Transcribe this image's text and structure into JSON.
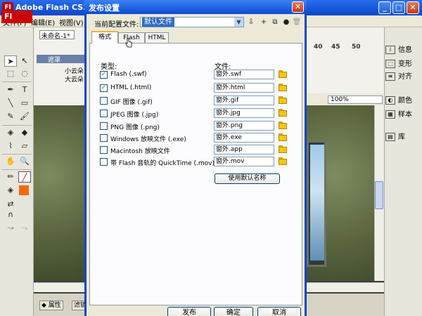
{
  "flash_window": {
    "title": "Adobe Flash CS3 Pr",
    "app_icon": "Fl",
    "menu": [
      "文件(F)",
      "编辑(E)",
      "视图(V)"
    ],
    "logo": "Fl",
    "document_tab": "未命名-1*",
    "layers": [
      "遮罩",
      "小云朵",
      "大云朵"
    ],
    "frame_numbers": [
      "40",
      "45",
      "50"
    ],
    "zoom": "100%",
    "bottom_tabs": [
      "属性",
      "滤镜"
    ]
  },
  "right_panel": {
    "items": [
      {
        "icon": "info-icon",
        "label": "信息"
      },
      {
        "icon": "transform-icon",
        "label": "变形"
      },
      {
        "icon": "align-icon",
        "label": "对齐"
      },
      {
        "icon": "color-icon",
        "label": "颜色"
      },
      {
        "icon": "swatches-icon",
        "label": "样本"
      },
      {
        "icon": "library-icon",
        "label": "库"
      }
    ]
  },
  "dialog": {
    "title": "发布设置",
    "close_glyph": "✕",
    "profile_label": "当前配置文件:",
    "profile_value": "默认文件",
    "tabs": [
      "格式",
      "Flash",
      "HTML"
    ],
    "active_tab": "格式",
    "type_header": "类型:",
    "file_header": "文件:",
    "formats": [
      {
        "label": "Flash (.swf)",
        "checked": true,
        "file": "窗外.swf"
      },
      {
        "label": "HTML (.html)",
        "checked": true,
        "file": "窗外.html"
      },
      {
        "label": "GIF 图像 (.gif)",
        "checked": false,
        "file": "窗外.gif"
      },
      {
        "label": "JPEG 图像 (.jpg)",
        "checked": false,
        "file": "窗外.jpg"
      },
      {
        "label": "PNG 图像 (.png)",
        "checked": false,
        "file": "窗外.png"
      },
      {
        "label": "Windows 放映文件 (.exe)",
        "checked": false,
        "file": "窗外.exe"
      },
      {
        "label": "Macintosh 放映文件",
        "checked": false,
        "file": "窗外.app"
      },
      {
        "label": "带 Flash 音轨的 QuickTime (.mov)",
        "checked": false,
        "file": "窗外.mov"
      }
    ],
    "default_names_button": "使用默认名称",
    "buttons": {
      "publish": "发布",
      "ok": "确定",
      "cancel": "取消"
    }
  }
}
